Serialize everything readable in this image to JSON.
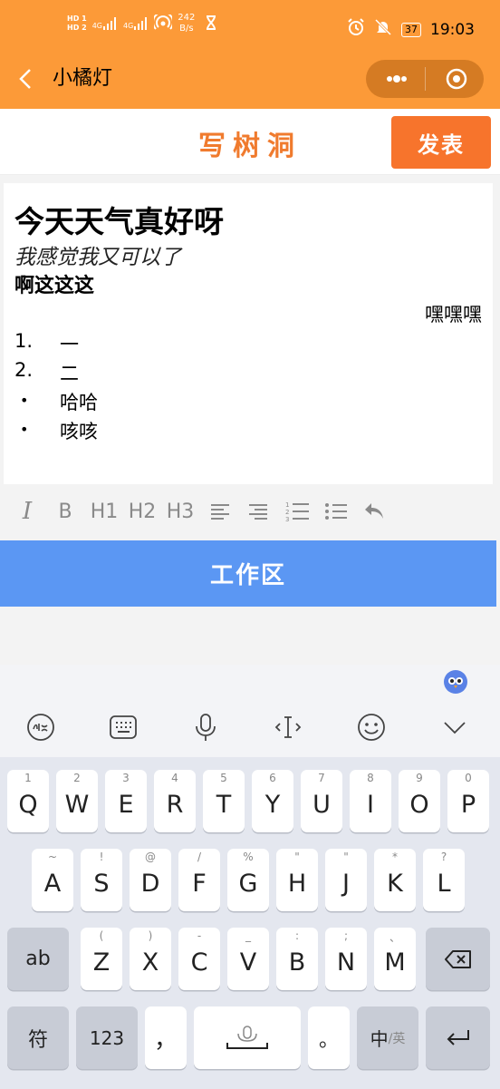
{
  "status_bar": {
    "sim1": "HD 1",
    "sim2": "HD 2",
    "net1": "4G",
    "net2": "4G",
    "speed_value": "242",
    "speed_unit": "B/s",
    "battery": "37",
    "time": "19:03"
  },
  "nav": {
    "title": "小橘灯"
  },
  "header": {
    "title": "写树洞",
    "publish_label": "发表"
  },
  "editor": {
    "heading": "今天天气真好呀",
    "italic_line": "我感觉我又可以了",
    "bold_line": "啊这这这",
    "right_line": "嘿嘿嘿",
    "ordered": [
      {
        "num": "1.",
        "text": "一"
      },
      {
        "num": "2.",
        "text": "二"
      }
    ],
    "bullets": [
      {
        "bullet": "•",
        "text": "哈哈"
      },
      {
        "bullet": "•",
        "text": "咳咳"
      }
    ]
  },
  "toolbar": {
    "items": [
      "italic-icon",
      "bold-icon",
      "h1-icon",
      "h2-icon",
      "h3-icon",
      "align-left-icon",
      "align-right-icon",
      "ordered-list-icon",
      "bullet-list-icon",
      "undo-icon"
    ],
    "italic": "I",
    "bold": "B",
    "h1": "H1",
    "h2": "H2",
    "h3": "H3"
  },
  "workarea": {
    "label": "工作区"
  },
  "keyboard": {
    "row1": [
      {
        "hint": "1",
        "key": "Q"
      },
      {
        "hint": "2",
        "key": "W"
      },
      {
        "hint": "3",
        "key": "E"
      },
      {
        "hint": "4",
        "key": "R"
      },
      {
        "hint": "5",
        "key": "T"
      },
      {
        "hint": "6",
        "key": "Y"
      },
      {
        "hint": "7",
        "key": "U"
      },
      {
        "hint": "8",
        "key": "I"
      },
      {
        "hint": "9",
        "key": "O"
      },
      {
        "hint": "0",
        "key": "P"
      }
    ],
    "row2": [
      {
        "hint": "~",
        "key": "A"
      },
      {
        "hint": "!",
        "key": "S"
      },
      {
        "hint": "@",
        "key": "D"
      },
      {
        "hint": "/",
        "key": "F"
      },
      {
        "hint": "%",
        "key": "G"
      },
      {
        "hint": "\"",
        "key": "H"
      },
      {
        "hint": "\"",
        "key": "J"
      },
      {
        "hint": "*",
        "key": "K"
      },
      {
        "hint": "?",
        "key": "L"
      }
    ],
    "row3": [
      {
        "hint": "(",
        "key": "Z"
      },
      {
        "hint": ")",
        "key": "X"
      },
      {
        "hint": "-",
        "key": "C"
      },
      {
        "hint": "_",
        "key": "V"
      },
      {
        "hint": ":",
        "key": "B"
      },
      {
        "hint": ";",
        "key": "N"
      },
      {
        "hint": "、",
        "key": "M"
      }
    ],
    "ab_label": "ab",
    "symbol_label": "符",
    "num_label": "123",
    "comma_label": "，",
    "period_label": "。",
    "lang_label_main": "中",
    "lang_label_alt": "/英"
  },
  "colors": {
    "orange": "#fc9a38",
    "accent": "#f7742c",
    "blue": "#5b97f3"
  }
}
